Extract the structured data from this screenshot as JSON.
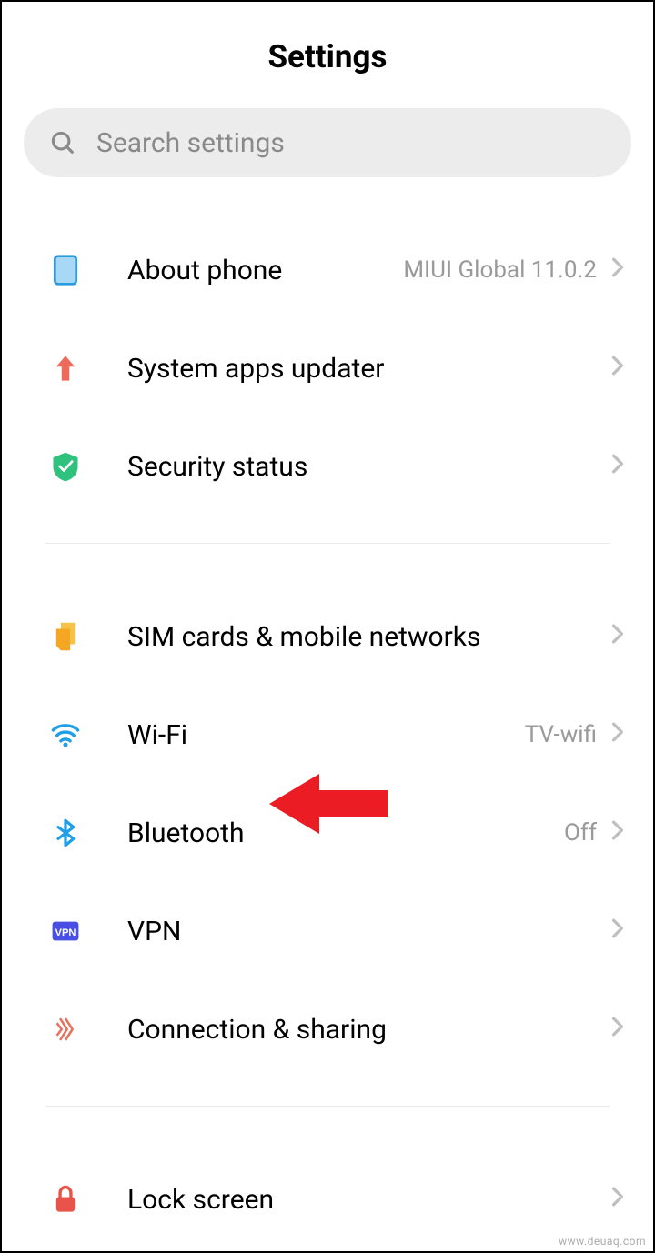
{
  "header": {
    "title": "Settings"
  },
  "search": {
    "placeholder": "Search settings"
  },
  "groups": [
    {
      "items": [
        {
          "icon": "phone-icon",
          "label": "About phone",
          "value": "MIUI Global 11.0.2"
        },
        {
          "icon": "update-icon",
          "label": "System apps updater",
          "value": ""
        },
        {
          "icon": "shield-icon",
          "label": "Security status",
          "value": ""
        }
      ]
    },
    {
      "items": [
        {
          "icon": "sim-icon",
          "label": "SIM cards & mobile networks",
          "value": ""
        },
        {
          "icon": "wifi-icon",
          "label": "Wi-Fi",
          "value": "TV-wifi"
        },
        {
          "icon": "bluetooth-icon",
          "label": "Bluetooth",
          "value": "Off"
        },
        {
          "icon": "vpn-icon",
          "label": "VPN",
          "value": ""
        },
        {
          "icon": "share-icon",
          "label": "Connection & sharing",
          "value": ""
        }
      ]
    },
    {
      "items": [
        {
          "icon": "lock-icon",
          "label": "Lock screen",
          "value": ""
        }
      ]
    }
  ],
  "annotation": {
    "target": "bluetooth"
  },
  "watermark": "www.deuaq.com"
}
